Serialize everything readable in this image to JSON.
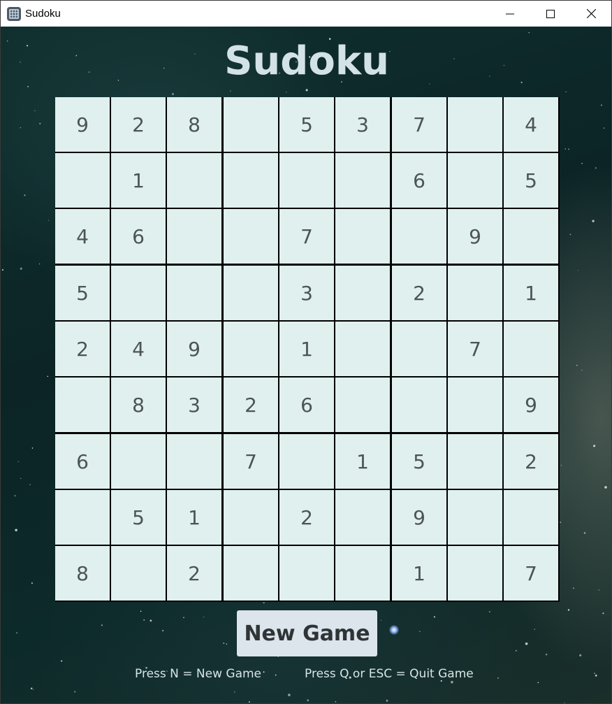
{
  "window": {
    "title": "Sudoku",
    "controls": [
      "minimize",
      "maximize",
      "close"
    ]
  },
  "game": {
    "title": "Sudoku",
    "new_game_label": "New Game",
    "hint_new": "Press N = New Game",
    "hint_quit": "Press Q or ESC = Quit Game"
  },
  "board": {
    "rows": [
      [
        "9",
        "2",
        "8",
        "",
        "5",
        "3",
        "7",
        "",
        "4"
      ],
      [
        "",
        "1",
        "",
        "",
        "",
        "",
        "6",
        "",
        "5"
      ],
      [
        "4",
        "6",
        "",
        "",
        "7",
        "",
        "",
        "9",
        ""
      ],
      [
        "5",
        "",
        "",
        "",
        "3",
        "",
        "2",
        "",
        "1"
      ],
      [
        "2",
        "4",
        "9",
        "",
        "1",
        "",
        "",
        "7",
        ""
      ],
      [
        "",
        "8",
        "3",
        "2",
        "6",
        "",
        "",
        "",
        "9"
      ],
      [
        "6",
        "",
        "",
        "7",
        "",
        "1",
        "5",
        "",
        "2"
      ],
      [
        "",
        "5",
        "1",
        "",
        "2",
        "",
        "9",
        "",
        ""
      ],
      [
        "8",
        "",
        "2",
        "",
        "",
        "",
        "1",
        "",
        "7"
      ]
    ]
  },
  "colors": {
    "cell_background": "#e0f0ef",
    "digit": "#4d5456",
    "title_text": "#d3e2e6",
    "button_background": "#dce4ec"
  }
}
